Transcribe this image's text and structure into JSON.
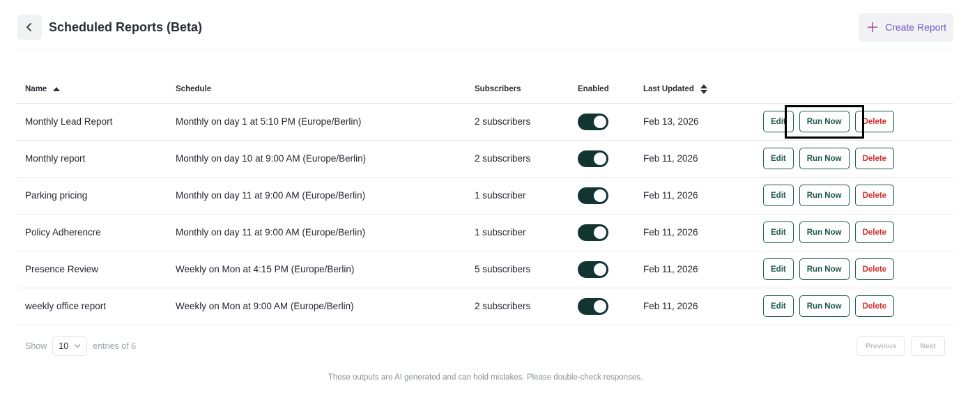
{
  "header": {
    "title": "Scheduled Reports (Beta)",
    "create_label": "Create Report",
    "back_icon": "chevron-left-icon",
    "create_icon": "plus-icon"
  },
  "table": {
    "columns": {
      "name": "Name",
      "schedule": "Schedule",
      "subscribers": "Subscribers",
      "enabled": "Enabled",
      "last_updated": "Last Updated"
    },
    "sort": {
      "column": "name",
      "direction": "ascending"
    },
    "rows": [
      {
        "name": "Monthly Lead Report",
        "schedule": "Monthly on day 1 at 5:10 PM (Europe/Berlin)",
        "subscribers": "2 subscribers",
        "enabled": true,
        "last_updated": "Feb 13, 2026"
      },
      {
        "name": "Monthly report",
        "schedule": "Monthly on day 10 at 9:00 AM (Europe/Berlin)",
        "subscribers": "2 subscribers",
        "enabled": true,
        "last_updated": "Feb 11, 2026"
      },
      {
        "name": "Parking pricing",
        "schedule": "Monthly on day 11 at 9:00 AM (Europe/Berlin)",
        "subscribers": "1 subscriber",
        "enabled": true,
        "last_updated": "Feb 11, 2026"
      },
      {
        "name": "Policy Adherencre",
        "schedule": "Monthly on day 11 at 9:00 AM (Europe/Berlin)",
        "subscribers": "1 subscriber",
        "enabled": true,
        "last_updated": "Feb 11, 2026"
      },
      {
        "name": "Presence Review",
        "schedule": "Weekly on Mon at 4:15 PM (Europe/Berlin)",
        "subscribers": "5 subscribers",
        "enabled": true,
        "last_updated": "Feb 11, 2026"
      },
      {
        "name": "weekly office report",
        "schedule": "Weekly on Mon at 9:00 AM (Europe/Berlin)",
        "subscribers": "2 subscribers",
        "enabled": true,
        "last_updated": "Feb 11, 2026"
      }
    ],
    "actions": {
      "edit": "Edit",
      "run_now": "Run Now",
      "delete": "Delete"
    }
  },
  "pagination": {
    "show_label": "Show",
    "page_size": "10",
    "entries_label": "entries of 6",
    "previous": "Previous",
    "next": "Next"
  },
  "disclaimer": "These outputs are AI generated and can hold mistakes. Please double-check responses.",
  "colors": {
    "accent_dark_green": "#123532",
    "button_green": "#1d5a4d",
    "delete_red": "#d32f2f",
    "create_purple": "#7a55c9"
  }
}
